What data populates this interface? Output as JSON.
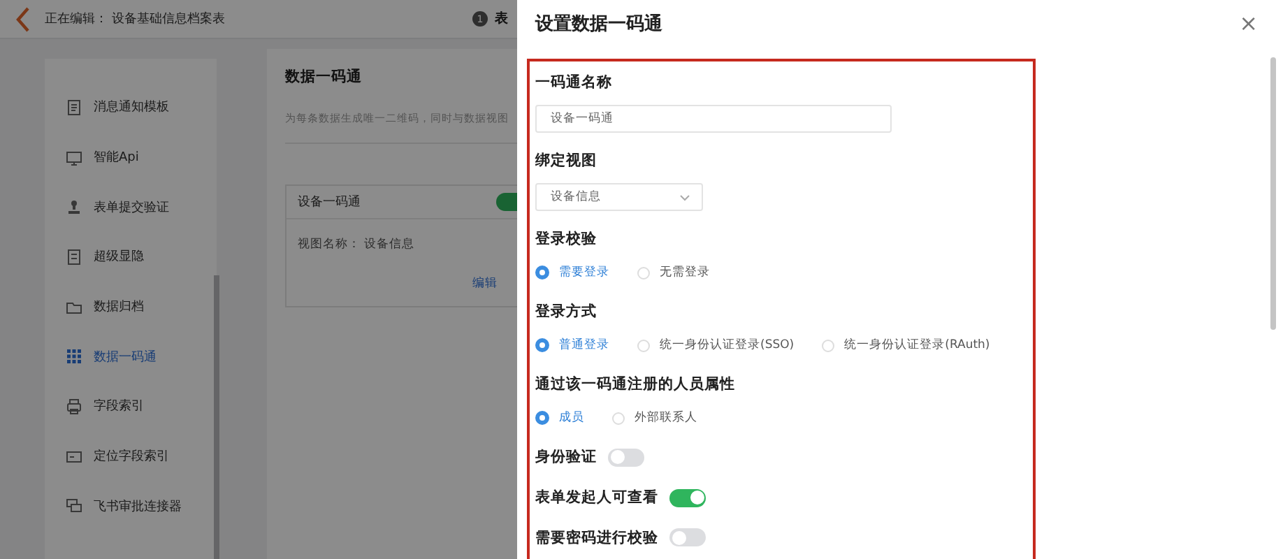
{
  "header": {
    "title": "正在编辑： 设备基础信息档案表",
    "step_number": "1",
    "step_label": "表"
  },
  "sidebar": {
    "items": [
      {
        "label": "消息通知模板",
        "selected": false
      },
      {
        "label": "智能Api",
        "selected": false
      },
      {
        "label": "表单提交验证",
        "selected": false
      },
      {
        "label": "超级显隐",
        "selected": false
      },
      {
        "label": "数据归档",
        "selected": false
      },
      {
        "label": "数据一码通",
        "selected": true
      },
      {
        "label": "字段索引",
        "selected": false
      },
      {
        "label": "定位字段索引",
        "selected": false
      },
      {
        "label": "飞书审批连接器",
        "selected": false
      }
    ]
  },
  "main": {
    "title": "数据一码通",
    "description": "为每条数据生成唯一二维码，同时与数据视图",
    "card": {
      "name": "设备一码通",
      "on": true,
      "view_label": "视图名称：",
      "view_name": "设备信息",
      "edit_link": "编辑"
    }
  },
  "drawer": {
    "title": "设置数据一码通",
    "close": "×",
    "fields": [
      {
        "kind": "input",
        "label": "一码通名称",
        "value": "设备一码通"
      },
      {
        "kind": "select",
        "label": "绑定视图",
        "value": "设备信息"
      },
      {
        "kind": "radio",
        "label": "登录校验",
        "options": [
          {
            "label": "需要登录",
            "selected": true
          },
          {
            "label": "无需登录",
            "selected": false
          }
        ]
      },
      {
        "kind": "radio",
        "label": "登录方式",
        "options": [
          {
            "label": "普通登录",
            "selected": true
          },
          {
            "label": "统一身份认证登录(SSO)",
            "selected": false
          },
          {
            "label": "统一身份认证登录(RAuth)",
            "selected": false
          }
        ]
      },
      {
        "kind": "radio",
        "label": "通过该一码通注册的人员属性",
        "options": [
          {
            "label": "成员",
            "selected": true
          },
          {
            "label": "外部联系人",
            "selected": false
          }
        ]
      },
      {
        "kind": "switch",
        "label": "身份验证",
        "on": false
      },
      {
        "kind": "switch",
        "label": "表单发起人可查看",
        "on": true
      },
      {
        "kind": "switch",
        "label": "需要密码进行校验",
        "on": false
      }
    ]
  }
}
